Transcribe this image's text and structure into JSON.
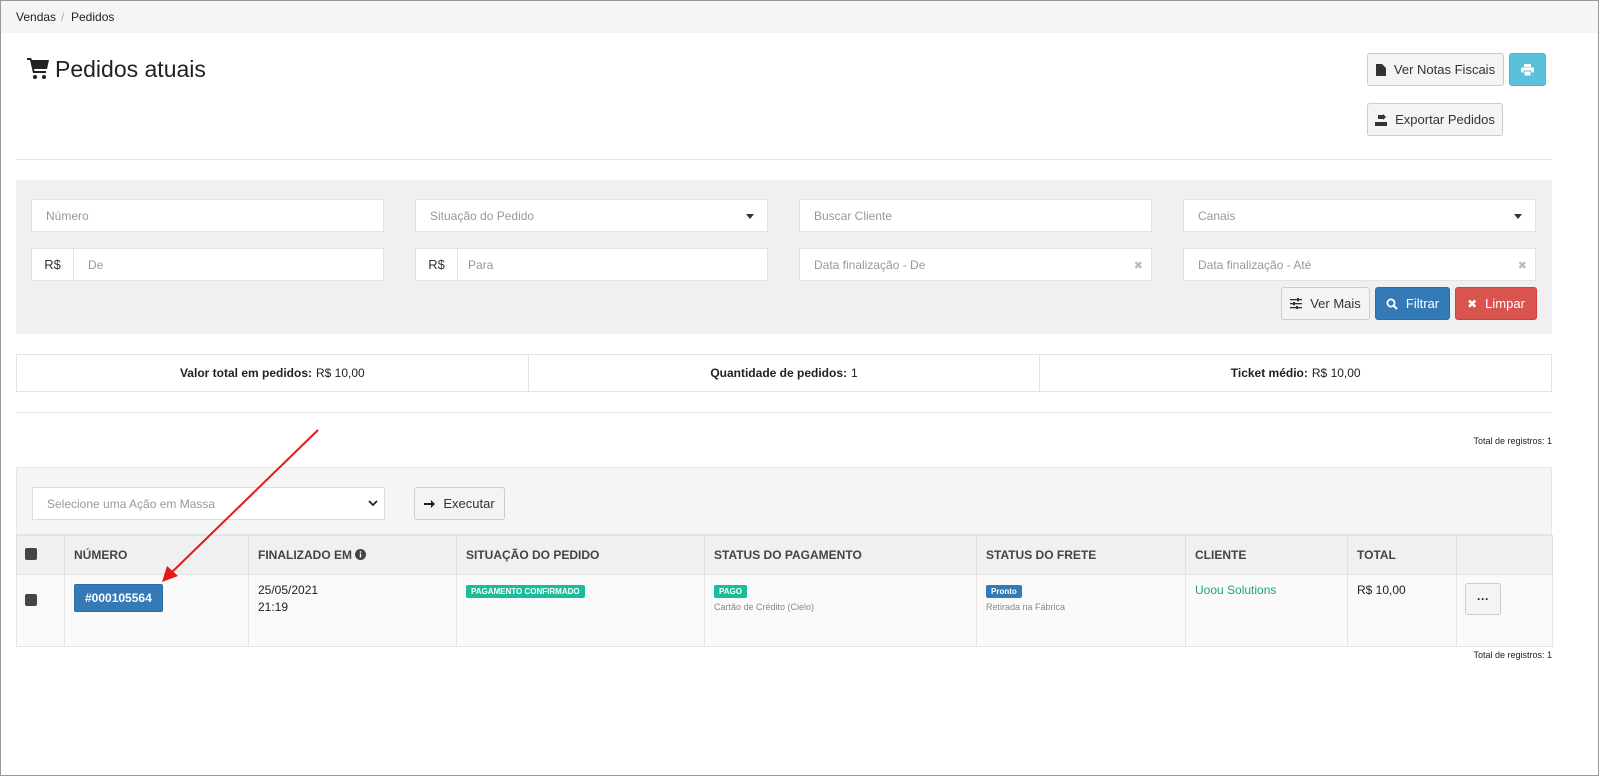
{
  "breadcrumb": {
    "root": "Vendas",
    "separator": "/",
    "current": "Pedidos"
  },
  "page": {
    "title": "Pedidos atuais"
  },
  "toolbar": {
    "fiscal_label": "Ver Notas Fiscais",
    "export_label": "Exportar Pedidos",
    "print_color": "#5bc0de"
  },
  "filters": {
    "numero_placeholder": "Número",
    "situacao_placeholder": "Situação do Pedido",
    "cliente_placeholder": "Buscar Cliente",
    "canais_placeholder": "Canais",
    "currency": "R$",
    "valor_de_placeholder": "De",
    "valor_para_placeholder": "Para",
    "data_de_placeholder": "Data finalização - De",
    "data_ate_placeholder": "Data finalização - Até",
    "ver_mais_label": "Ver Mais",
    "filtrar_label": "Filtrar",
    "limpar_label": "Limpar"
  },
  "stats": {
    "total_label": "Valor total em pedidos:",
    "total_value": "R$ 10,00",
    "qtd_label": "Quantidade de pedidos:",
    "qtd_value": "1",
    "ticket_label": "Ticket médio:",
    "ticket_value": "R$ 10,00"
  },
  "records": {
    "top": "Total de registros: 1",
    "bottom": "Total de registros: 1"
  },
  "mass_action": {
    "placeholder": "Selecione uma Ação em Massa",
    "execute_label": "Executar"
  },
  "table": {
    "headers": {
      "numero": "NÚMERO",
      "finalizado": "FINALIZADO EM",
      "situacao": "SITUAÇÃO DO PEDIDO",
      "pagamento": "STATUS DO PAGAMENTO",
      "frete": "STATUS DO FRETE",
      "cliente": "CLIENTE",
      "total": "TOTAL"
    },
    "rows": [
      {
        "numero": "#000105564",
        "date": "25/05/2021",
        "time": "21:19",
        "situacao": "PAGAMENTO CONFIRMADO",
        "pagamento": "PAGO",
        "pagamento_metodo": "Cartão de Crédito (Cielo)",
        "frete": "Pronto",
        "frete_metodo": "Retirada na Fábrica",
        "cliente": "Uoou Solutions",
        "total": "R$ 10,00",
        "more": "···"
      }
    ]
  },
  "colors": {
    "primary": "#337ab7",
    "danger": "#d9534f",
    "success": "#1abc9c",
    "link": "#1fa27a",
    "annotation": "#e8171b"
  }
}
